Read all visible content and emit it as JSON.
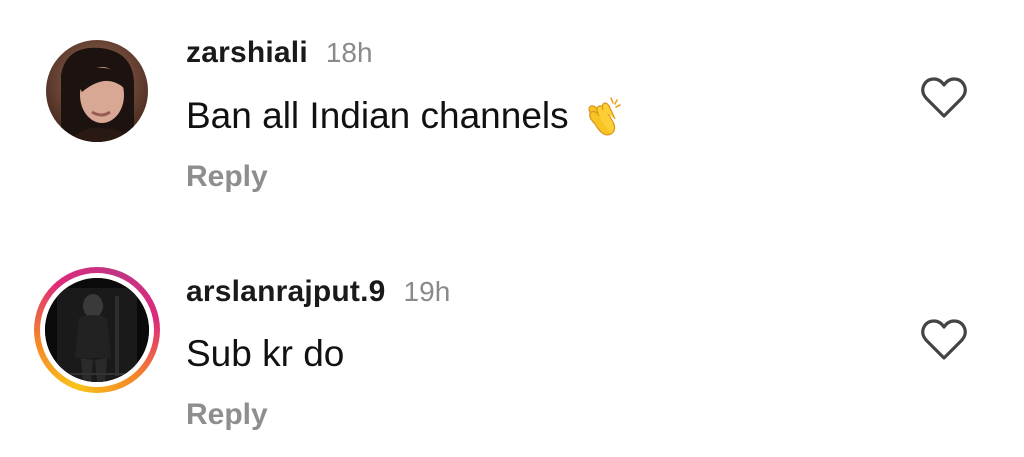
{
  "comments": [
    {
      "username": "zarshiali",
      "time": "18h",
      "text": "Ban all Indian channels",
      "emoji": "clapping-hands-icon",
      "reply_label": "Reply",
      "like_icon": "heart-outline-icon",
      "has_story_ring": false
    },
    {
      "username": "arslanrajput.9",
      "time": "19h",
      "text": "Sub kr do",
      "reply_label": "Reply",
      "like_icon": "heart-outline-icon",
      "has_story_ring": true
    }
  ],
  "colors": {
    "username": "#1a1a1a",
    "secondary_text": "#8e8e8e",
    "story_ring_start": "#f9c21a",
    "story_ring_end": "#c13584"
  }
}
